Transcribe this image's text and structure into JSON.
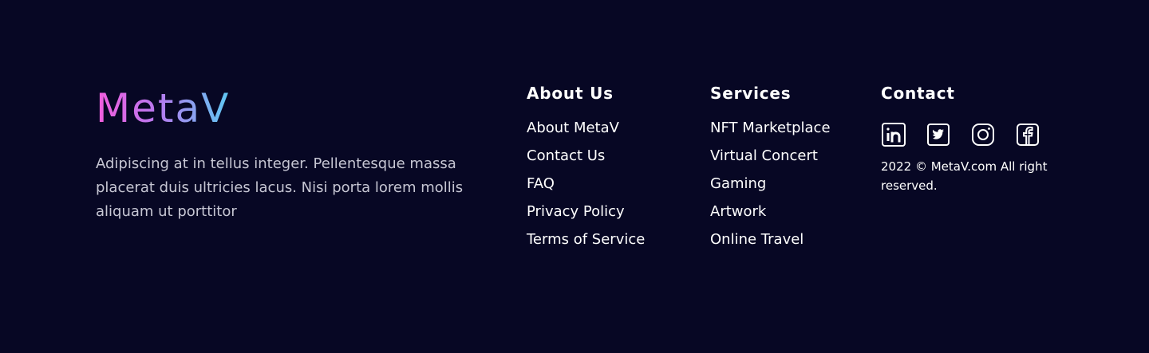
{
  "brand": {
    "logo_text": "MetaV",
    "description": "Adipiscing at in tellus integer. Pellentesque massa placerat duis ultricies lacus. Nisi porta lorem mollis aliquam ut porttitor",
    "gradient": [
      "#f45ddd",
      "#b978ef",
      "#5ec8f2"
    ]
  },
  "about": {
    "heading": "About Us",
    "links": [
      "About MetaV",
      "Contact Us",
      "FAQ",
      "Privacy Policy",
      "Terms of Service"
    ]
  },
  "services": {
    "heading": "Services",
    "links": [
      "NFT Marketplace",
      "Virtual Concert",
      "Gaming",
      "Artwork",
      "Online Travel"
    ]
  },
  "contact": {
    "heading": "Contact",
    "socials": [
      "linkedin-icon",
      "twitter-icon",
      "instagram-icon",
      "facebook-icon"
    ],
    "copyright": "2022 © MetaV.com All right reserved."
  },
  "colors": {
    "background": "#070724",
    "text": "#ffffff",
    "muted_text": "#c6c6d3"
  }
}
